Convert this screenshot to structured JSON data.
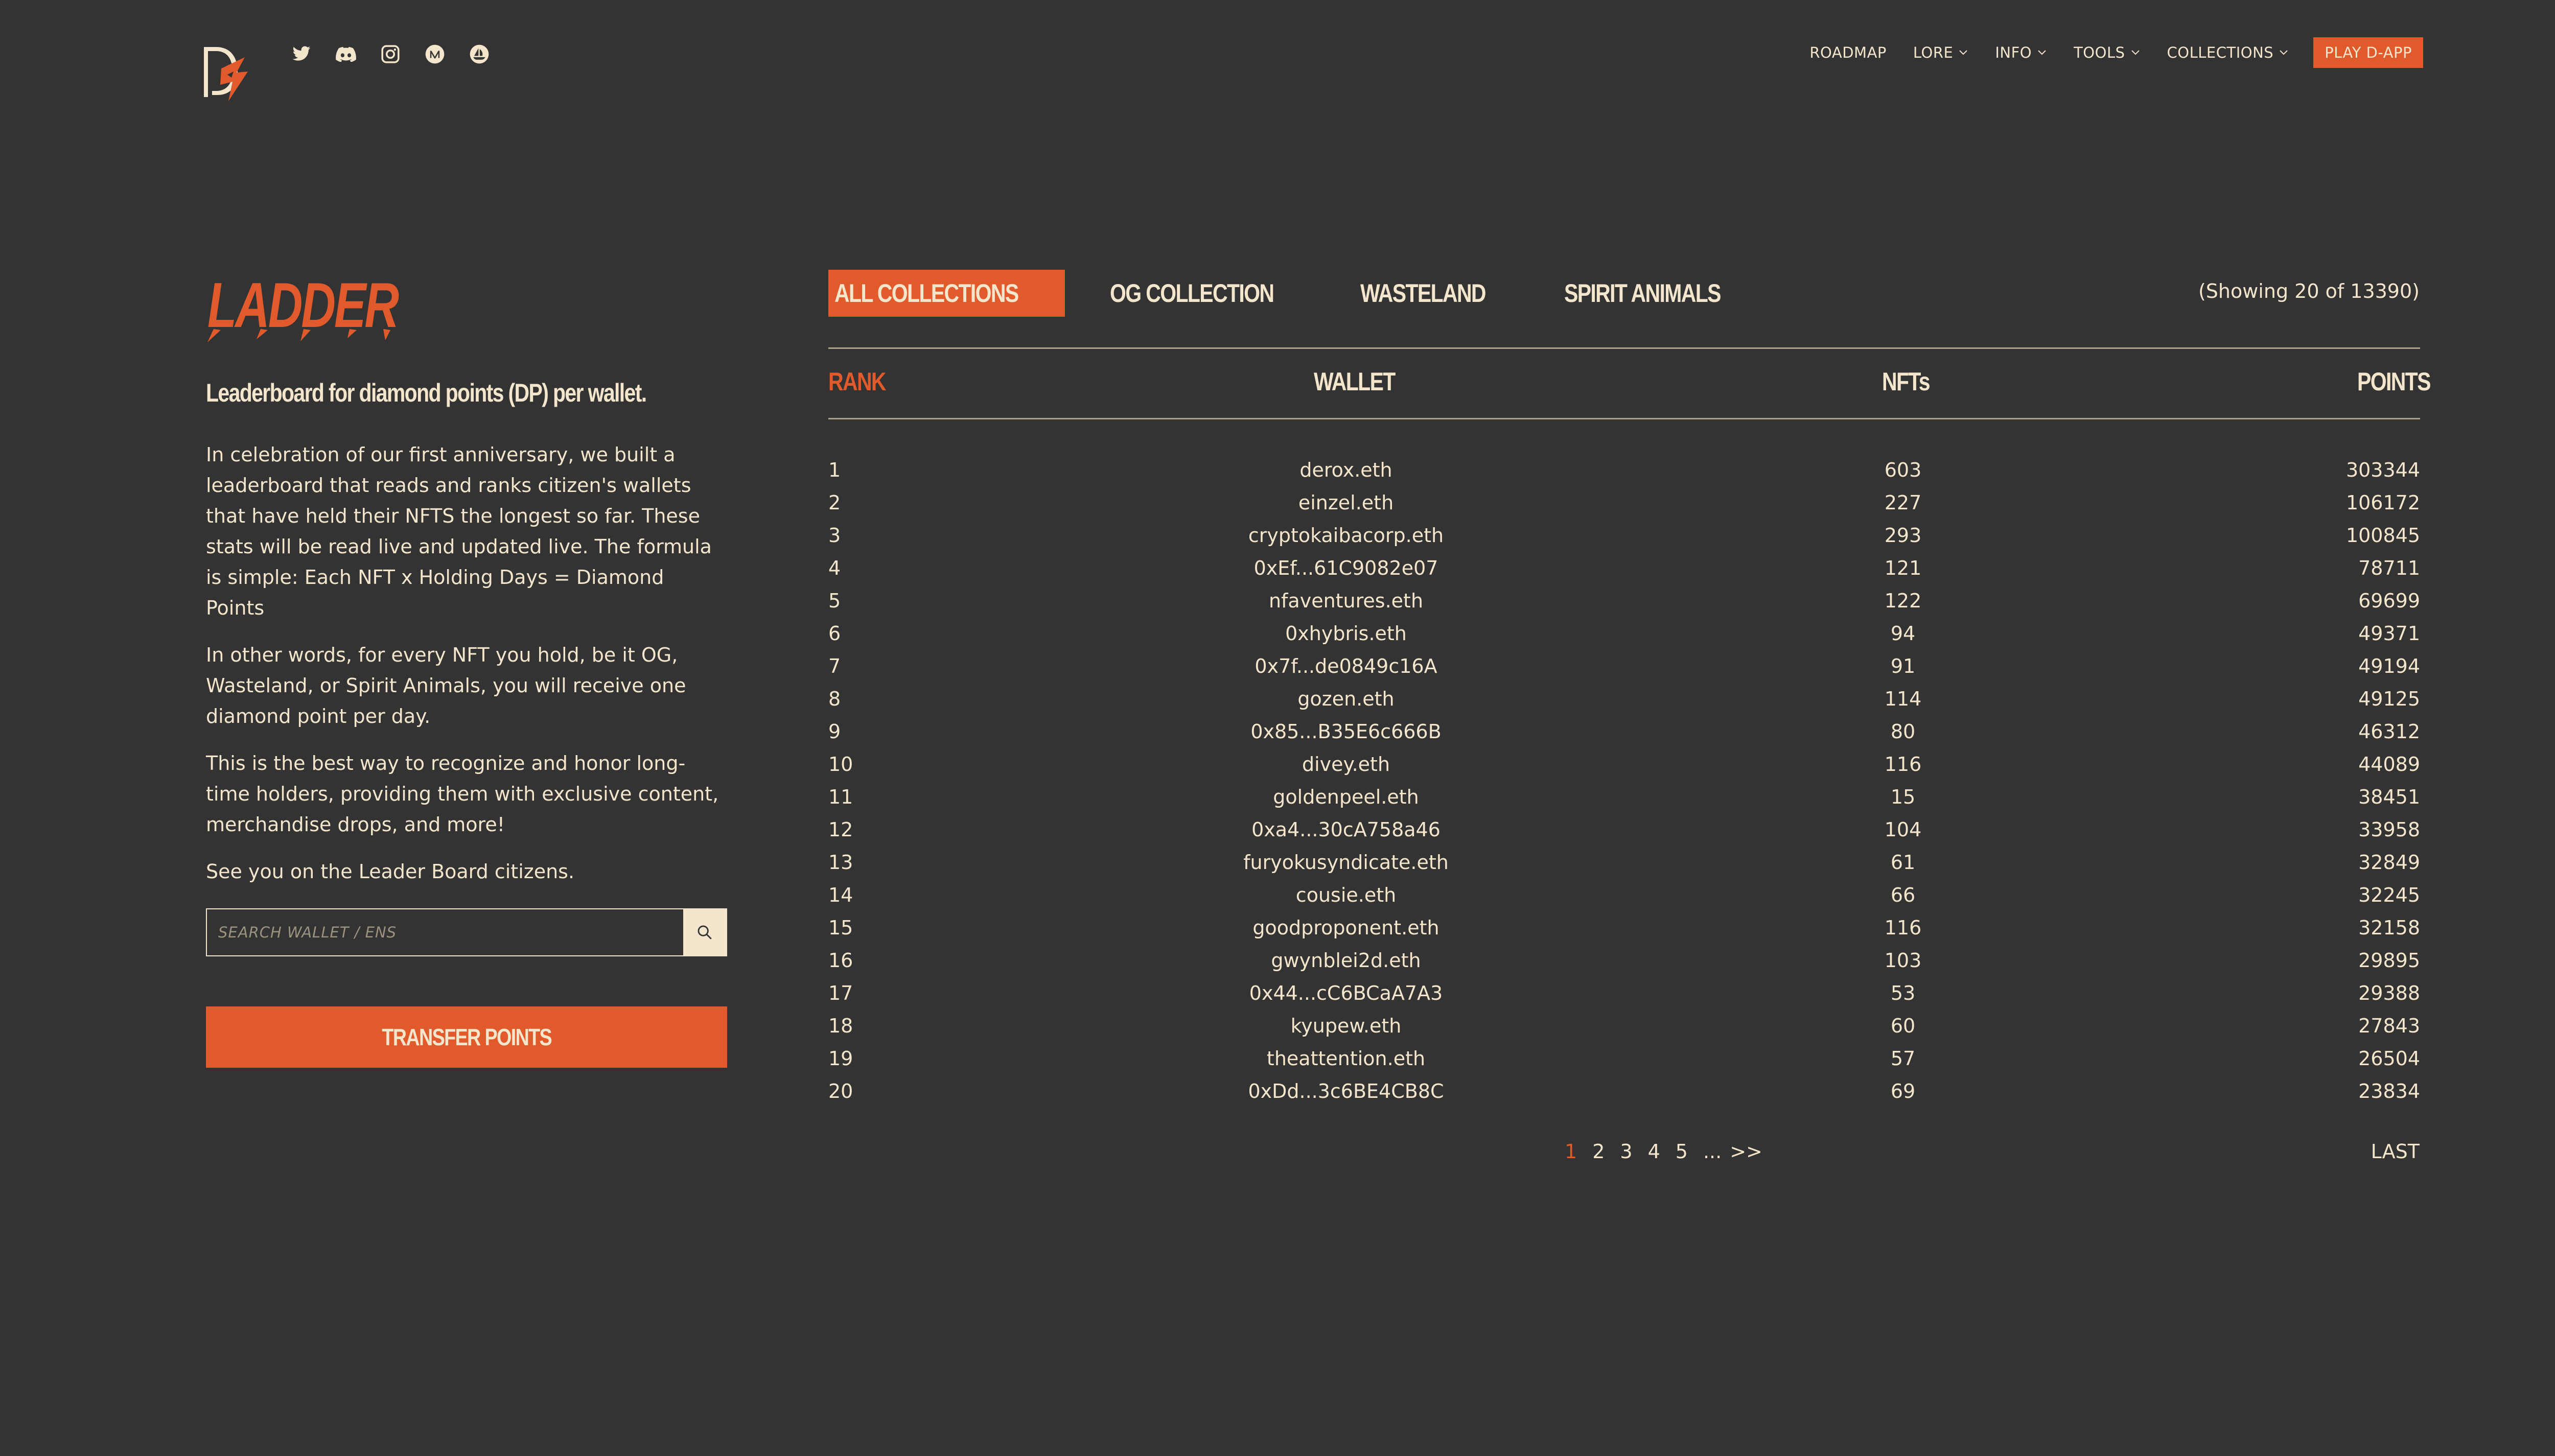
{
  "header": {
    "logo_name": "dope-logo",
    "socials": [
      {
        "name": "twitter-icon"
      },
      {
        "name": "discord-icon"
      },
      {
        "name": "instagram-icon"
      },
      {
        "name": "medium-icon"
      },
      {
        "name": "opensea-icon"
      }
    ],
    "nav": {
      "roadmap": "ROADMAP",
      "lore": "LORE",
      "info": "INFO",
      "tools": "TOOLS",
      "collections": "COLLECTIONS",
      "play": "PLAY D-APP"
    }
  },
  "left": {
    "title": "LADDER",
    "subtitle": "Leaderboard for diamond points (DP) per wallet.",
    "paragraphs": [
      "In celebration of our first anniversary, we built a leaderboard that reads and ranks citizen's wallets that have held their NFTS the longest so far. These stats will be read live and updated live. The formula is simple: Each NFT x Holding Days = Diamond Points",
      "In other words, for every NFT you hold, be it OG, Wasteland, or Spirit Animals, you will receive one diamond point per day.",
      "This is the best way to recognize and honor long-time holders, providing them with exclusive content, merchandise drops, and more!",
      "See you on the Leader Board citizens."
    ],
    "search_placeholder": "SEARCH WALLET / ENS",
    "transfer_label": "TRANSFER POINTS"
  },
  "tabs": [
    "ALL COLLECTIONS",
    "OG COLLECTION",
    "WASTELAND",
    "SPIRIT ANIMALS"
  ],
  "showing": "(Showing 20 of 13390)",
  "table": {
    "headers": {
      "rank": "RANK",
      "wallet": "WALLET",
      "nfts": "NFTs",
      "points": "POINTS"
    },
    "rows": [
      {
        "rank": "1",
        "wallet": "derox.eth",
        "nfts": "603",
        "points": "303344"
      },
      {
        "rank": "2",
        "wallet": "einzel.eth",
        "nfts": "227",
        "points": "106172"
      },
      {
        "rank": "3",
        "wallet": "cryptokaibacorp.eth",
        "nfts": "293",
        "points": "100845"
      },
      {
        "rank": "4",
        "wallet": "0xEf...61C9082e07",
        "nfts": "121",
        "points": "78711"
      },
      {
        "rank": "5",
        "wallet": "nfaventures.eth",
        "nfts": "122",
        "points": "69699"
      },
      {
        "rank": "6",
        "wallet": "0xhybris.eth",
        "nfts": "94",
        "points": "49371"
      },
      {
        "rank": "7",
        "wallet": "0x7f...de0849c16A",
        "nfts": "91",
        "points": "49194"
      },
      {
        "rank": "8",
        "wallet": "gozen.eth",
        "nfts": "114",
        "points": "49125"
      },
      {
        "rank": "9",
        "wallet": "0x85...B35E6c666B",
        "nfts": "80",
        "points": "46312"
      },
      {
        "rank": "10",
        "wallet": "divey.eth",
        "nfts": "116",
        "points": "44089"
      },
      {
        "rank": "11",
        "wallet": "goldenpeel.eth",
        "nfts": "15",
        "points": "38451"
      },
      {
        "rank": "12",
        "wallet": "0xa4...30cA758a46",
        "nfts": "104",
        "points": "33958"
      },
      {
        "rank": "13",
        "wallet": "furyokusyndicate.eth",
        "nfts": "61",
        "points": "32849"
      },
      {
        "rank": "14",
        "wallet": "cousie.eth",
        "nfts": "66",
        "points": "32245"
      },
      {
        "rank": "15",
        "wallet": "goodproponent.eth",
        "nfts": "116",
        "points": "32158"
      },
      {
        "rank": "16",
        "wallet": "gwynblei2d.eth",
        "nfts": "103",
        "points": "29895"
      },
      {
        "rank": "17",
        "wallet": "0x44...cC6BCaA7A3",
        "nfts": "53",
        "points": "29388"
      },
      {
        "rank": "18",
        "wallet": "kyupew.eth",
        "nfts": "60",
        "points": "27843"
      },
      {
        "rank": "19",
        "wallet": "theattention.eth",
        "nfts": "57",
        "points": "26504"
      },
      {
        "rank": "20",
        "wallet": "0xDd...3c6BE4CB8C",
        "nfts": "69",
        "points": "23834"
      }
    ]
  },
  "pagination": {
    "pages": [
      "1",
      "2",
      "3",
      "4",
      "5"
    ],
    "current": "1",
    "ellipsis": "...",
    "next": ">>",
    "last": "LAST"
  },
  "colors": {
    "background": "#333333",
    "accent": "#e05a2b",
    "text": "#f4e6cc"
  }
}
